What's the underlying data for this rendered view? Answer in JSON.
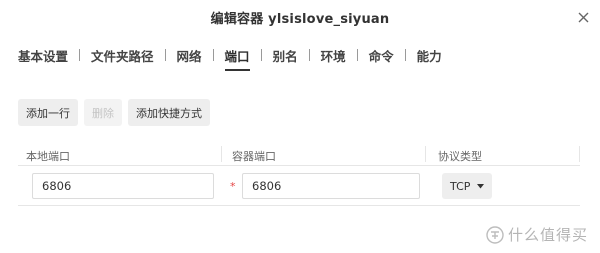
{
  "dialog": {
    "title": "编辑容器 ylsislove_siyuan",
    "close_icon": "close-icon"
  },
  "tabs": [
    {
      "label": "基本设置",
      "active": false
    },
    {
      "label": "文件夹路径",
      "active": false
    },
    {
      "label": "网络",
      "active": false
    },
    {
      "label": "端口",
      "active": true
    },
    {
      "label": "别名",
      "active": false
    },
    {
      "label": "环境",
      "active": false
    },
    {
      "label": "命令",
      "active": false
    },
    {
      "label": "能力",
      "active": false
    }
  ],
  "toolbar": {
    "add_row_label": "添加一行",
    "delete_label": "删除",
    "add_shortcut_label": "添加快捷方式"
  },
  "table": {
    "headers": [
      "本地端口",
      "容器端口",
      "协议类型"
    ],
    "rows": [
      {
        "local_port": "6806",
        "required_mark": "*",
        "container_port": "6806",
        "protocol": "TCP"
      }
    ]
  },
  "watermark": {
    "text": "什么值得买",
    "icon": "zhi-logo-icon"
  },
  "colors": {
    "required": "#e54545",
    "button_bg": "#eeeeee",
    "border": "#dcdcdc"
  }
}
